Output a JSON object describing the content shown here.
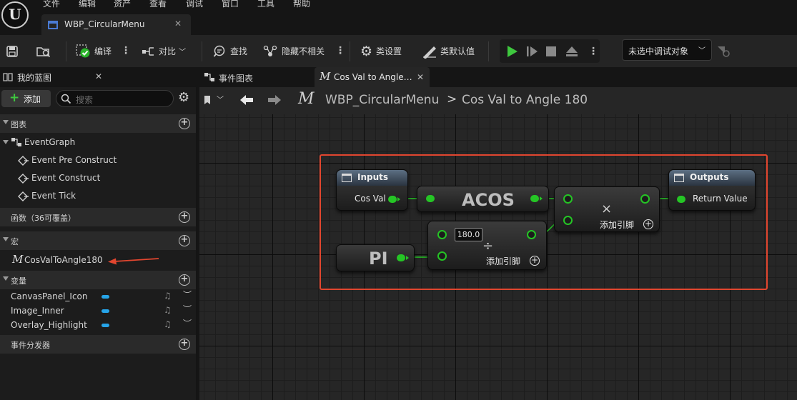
{
  "menu": [
    "文件",
    "编辑",
    "资产",
    "查看",
    "调试",
    "窗口",
    "工具",
    "帮助"
  ],
  "document_tab": {
    "title": "WBP_CircularMenu",
    "close": "✕"
  },
  "toolbar": {
    "compile": "编译",
    "diff": "对比",
    "find": "查找",
    "hide_unrelated": "隐藏不相关",
    "class_settings": "类设置",
    "class_defaults": "类默认值",
    "debug_target": "未选中调试对象"
  },
  "left_panel": {
    "title": "我的蓝图",
    "close": "✕",
    "add_button": "添加",
    "search_placeholder": "搜索",
    "sections": {
      "graphs": "图表",
      "functions": "函数（36可覆盖）",
      "macros": "宏",
      "variables": "变量",
      "dispatchers": "事件分发器"
    },
    "event_graph": "EventGraph",
    "events": [
      "Event Pre Construct",
      "Event Construct",
      "Event Tick"
    ],
    "macro_item": "CosValToAngle180",
    "variables": [
      "CanvasPanel_Icon",
      "Image_Inner",
      "Overlay_Highlight"
    ]
  },
  "graph_tabs": [
    {
      "label": "事件图表",
      "active": false
    },
    {
      "label": "Cos Val to Angle…",
      "active": true,
      "close": "✕"
    }
  ],
  "breadcrumb": {
    "root": "WBP_CircularMenu",
    "separator": ">",
    "current": "Cos Val to Angle 180"
  },
  "nodes": {
    "inputs": {
      "title": "Inputs",
      "pin": "Cos Val"
    },
    "acos": {
      "title": "ACOS"
    },
    "multiply": {
      "symbol": "×",
      "add_pin": "添加引脚"
    },
    "outputs": {
      "title": "Outputs",
      "pin": "Return Value"
    },
    "pi": {
      "title": "PI"
    },
    "divide": {
      "value": "180.0",
      "symbol": "÷",
      "add_pin": "添加引脚"
    }
  },
  "colors": {
    "pin": "#25c525",
    "highlight": "#e2462f",
    "accent": "#26a4e8"
  }
}
